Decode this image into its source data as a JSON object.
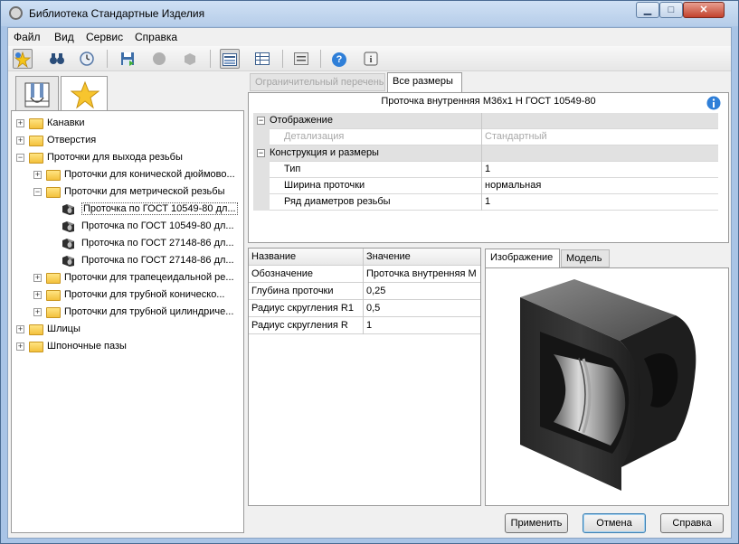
{
  "window": {
    "title": "Библиотека Стандартные Изделия",
    "controls": {
      "minimize": "▁",
      "maximize": "□",
      "close": "✕"
    }
  },
  "menu": [
    "Файл",
    "Вид",
    "Сервис",
    "Справка"
  ],
  "toolbar": {
    "icons": [
      "favorite-add-icon",
      "binoculars-icon",
      "clock-icon",
      "save-icon",
      "circle-icon",
      "shape-icon",
      "grid-view-icon",
      "table-view-icon",
      "list-view-icon",
      "help-icon",
      "info-icon"
    ],
    "help_glyph": "?",
    "info_glyph": "i"
  },
  "tree": {
    "items": [
      {
        "label": "Канавки",
        "level": 0,
        "expander": "+",
        "type": "folder"
      },
      {
        "label": "Отверстия",
        "level": 0,
        "expander": "+",
        "type": "folder"
      },
      {
        "label": "Проточки для выхода резьбы",
        "level": 0,
        "expander": "−",
        "type": "folder"
      },
      {
        "label": "Проточки для конической дюймово...",
        "level": 1,
        "expander": "+",
        "type": "folder"
      },
      {
        "label": "Проточки для метрической резьбы",
        "level": 1,
        "expander": "−",
        "type": "folder"
      },
      {
        "label": "Проточка по ГОСТ 10549-80 дл...",
        "level": 2,
        "expander": "",
        "type": "part",
        "selected": true
      },
      {
        "label": "Проточка по ГОСТ 10549-80 дл...",
        "level": 2,
        "expander": "",
        "type": "part"
      },
      {
        "label": "Проточка по ГОСТ 27148-86 дл...",
        "level": 2,
        "expander": "",
        "type": "part"
      },
      {
        "label": "Проточка по ГОСТ 27148-86 дл...",
        "level": 2,
        "expander": "",
        "type": "part"
      },
      {
        "label": "Проточки для трапецеидальной ре...",
        "level": 1,
        "expander": "+",
        "type": "folder"
      },
      {
        "label": "Проточки для трубной коническо...",
        "level": 1,
        "expander": "+",
        "type": "folder"
      },
      {
        "label": "Проточки для трубной цилиндриче...",
        "level": 1,
        "expander": "+",
        "type": "folder"
      },
      {
        "label": "Шлицы",
        "level": 0,
        "expander": "+",
        "type": "folder"
      },
      {
        "label": "Шпоночные пазы",
        "level": 0,
        "expander": "+",
        "type": "folder"
      }
    ]
  },
  "tabs": {
    "limit_list": "Ограничительный перечень",
    "all_sizes": "Все размеры"
  },
  "properties": {
    "title": "Проточка внутренняя M36x1 Н ГОСТ 10549-80",
    "rows": [
      {
        "name": "Отображение",
        "value": "",
        "category": true,
        "expander": "−"
      },
      {
        "name": "Детализация",
        "value": "Стандартный",
        "category": false,
        "disabled": true
      },
      {
        "name": "Конструкция и размеры",
        "value": "",
        "category": true,
        "expander": "−"
      },
      {
        "name": "Тип",
        "value": "1",
        "category": false
      },
      {
        "name": "Ширина проточки",
        "value": "нормальная",
        "category": false
      },
      {
        "name": "Ряд диаметров резьбы",
        "value": "1",
        "category": false
      }
    ]
  },
  "values_table": {
    "headers": {
      "name": "Название",
      "value": "Значение"
    },
    "rows": [
      {
        "name": "Обозначение",
        "value": "Проточка внутренняя М"
      },
      {
        "name": "Глубина проточки",
        "value": "0,25"
      },
      {
        "name": "Радиус скругления R1",
        "value": "0,5"
      },
      {
        "name": "Радиус скругления R",
        "value": "1"
      }
    ]
  },
  "image_tabs": {
    "image": "Изображение",
    "model": "Модель"
  },
  "buttons": {
    "apply": "Применить",
    "cancel": "Отмена",
    "help": "Справка"
  }
}
